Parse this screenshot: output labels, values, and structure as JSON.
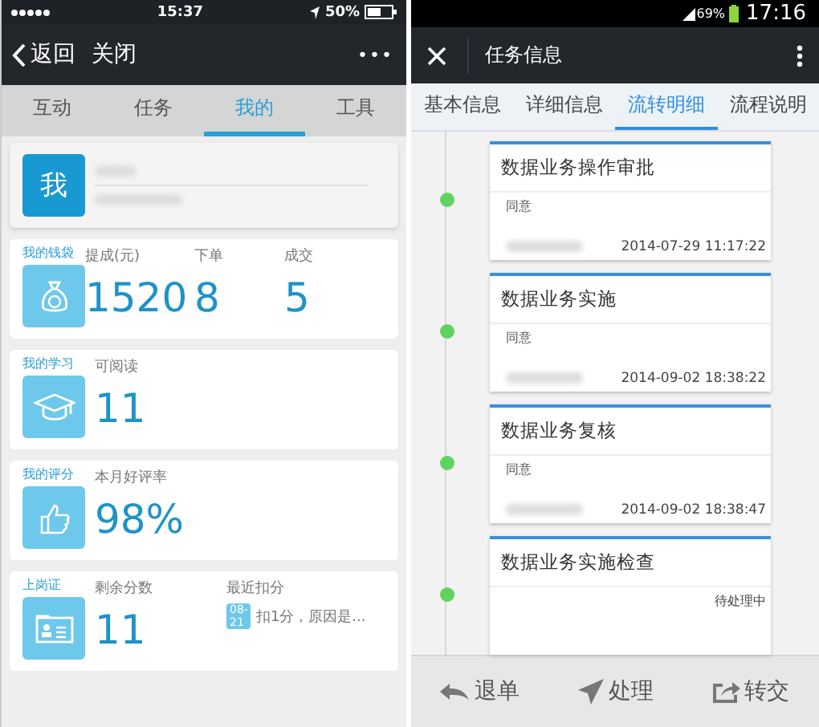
{
  "left_screen": {
    "status_bar": {
      "time": "15:37",
      "battery": "50%"
    },
    "nav_bar": {
      "back": "返回",
      "close": "关闭",
      "more": "•••"
    },
    "tabs": [
      {
        "label": "互动",
        "selected": false
      },
      {
        "label": "任务",
        "selected": false
      },
      {
        "label": "我的",
        "selected": true
      },
      {
        "label": "工具",
        "selected": false
      }
    ],
    "profile": {
      "avatar": "我"
    },
    "cards": [
      {
        "kind": "wallet",
        "title": "我的钱袋",
        "stats": [
          {
            "label": "提成(元)",
            "value": "1520"
          },
          {
            "label": "下单",
            "value": "8"
          },
          {
            "label": "成交",
            "value": "5"
          }
        ]
      },
      {
        "kind": "study",
        "title": "我的学习",
        "stats": [
          {
            "label": "可阅读",
            "value": "11"
          }
        ]
      },
      {
        "kind": "rating",
        "title": "我的评分",
        "stats": [
          {
            "label": "本月好评率",
            "value": "98%"
          }
        ]
      },
      {
        "kind": "certificate",
        "title": "上岗证",
        "stats": [
          {
            "label": "剩余分数",
            "value": "11"
          }
        ],
        "recent": {
          "label": "最近扣分",
          "date": "08-21",
          "text": "扣1分，原因是..."
        }
      }
    ]
  },
  "right_screen": {
    "status_bar": {
      "battery": "69%",
      "time": "17:16"
    },
    "nav_bar": {
      "title": "任务信息"
    },
    "tabs": [
      {
        "label": "基本信息",
        "selected": false
      },
      {
        "label": "详细信息",
        "selected": false
      },
      {
        "label": "流转明细",
        "selected": true
      },
      {
        "label": "流程说明",
        "selected": false
      }
    ],
    "steps": [
      {
        "title": "数据业务操作审批",
        "opinion": "同意",
        "time": "2014-07-29 11:17:22"
      },
      {
        "title": "数据业务实施",
        "opinion": "同意",
        "time": "2014-09-02 18:38:22"
      },
      {
        "title": "数据业务复核",
        "opinion": "同意",
        "time": "2014-09-02 18:38:47"
      },
      {
        "title": "数据业务实施检查",
        "status": "待处理中"
      }
    ],
    "actions": [
      {
        "kind": "return",
        "label": "退单"
      },
      {
        "kind": "process",
        "label": "处理"
      },
      {
        "kind": "forward",
        "label": "转交"
      }
    ]
  }
}
